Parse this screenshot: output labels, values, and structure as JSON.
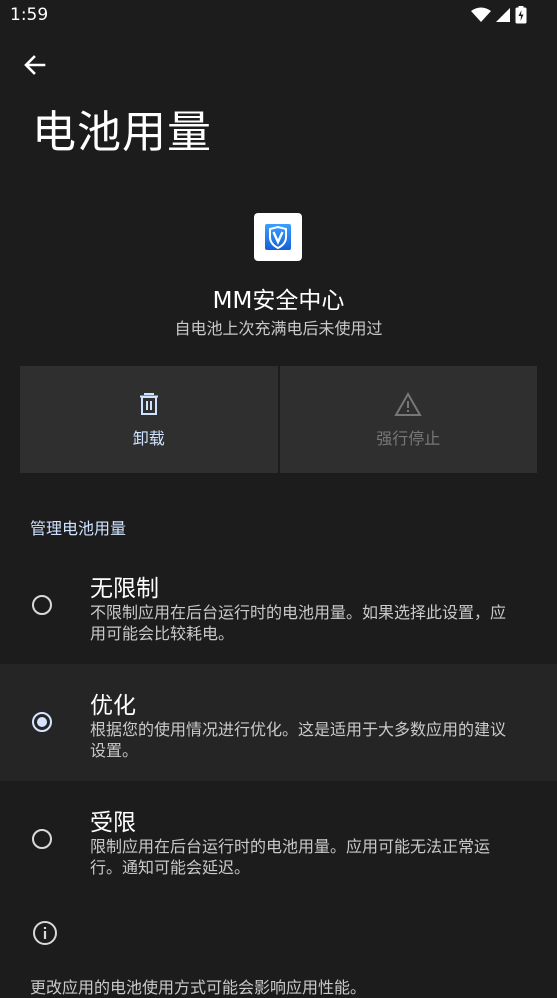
{
  "status_bar": {
    "time": "1:59"
  },
  "page": {
    "title": "电池用量"
  },
  "app": {
    "name": "MM安全中心",
    "subtitle": "自电池上次充满电后未使用过"
  },
  "actions": [
    {
      "label": "卸载",
      "icon": "trash-icon",
      "enabled": true
    },
    {
      "label": "强行停止",
      "icon": "warning-icon",
      "enabled": false
    }
  ],
  "section": {
    "header": "管理电池用量"
  },
  "options": [
    {
      "title": "无限制",
      "description": "不限制应用在后台运行时的电池用量。如果选择此设置，应用可能会比较耗电。",
      "selected": false
    },
    {
      "title": "优化",
      "description": "根据您的使用情况进行优化。这是适用于大多数应用的建议设置。",
      "selected": true
    },
    {
      "title": "受限",
      "description": "限制应用在后台运行时的电池用量。应用可能无法正常运行。通知可能会延迟。",
      "selected": false
    }
  ],
  "footer": {
    "text": "更改应用的电池使用方式可能会影响应用性能。"
  },
  "colors": {
    "background": "#1c1c1c",
    "accent": "#cfe2ff",
    "button_bg": "#2f2f2f"
  }
}
